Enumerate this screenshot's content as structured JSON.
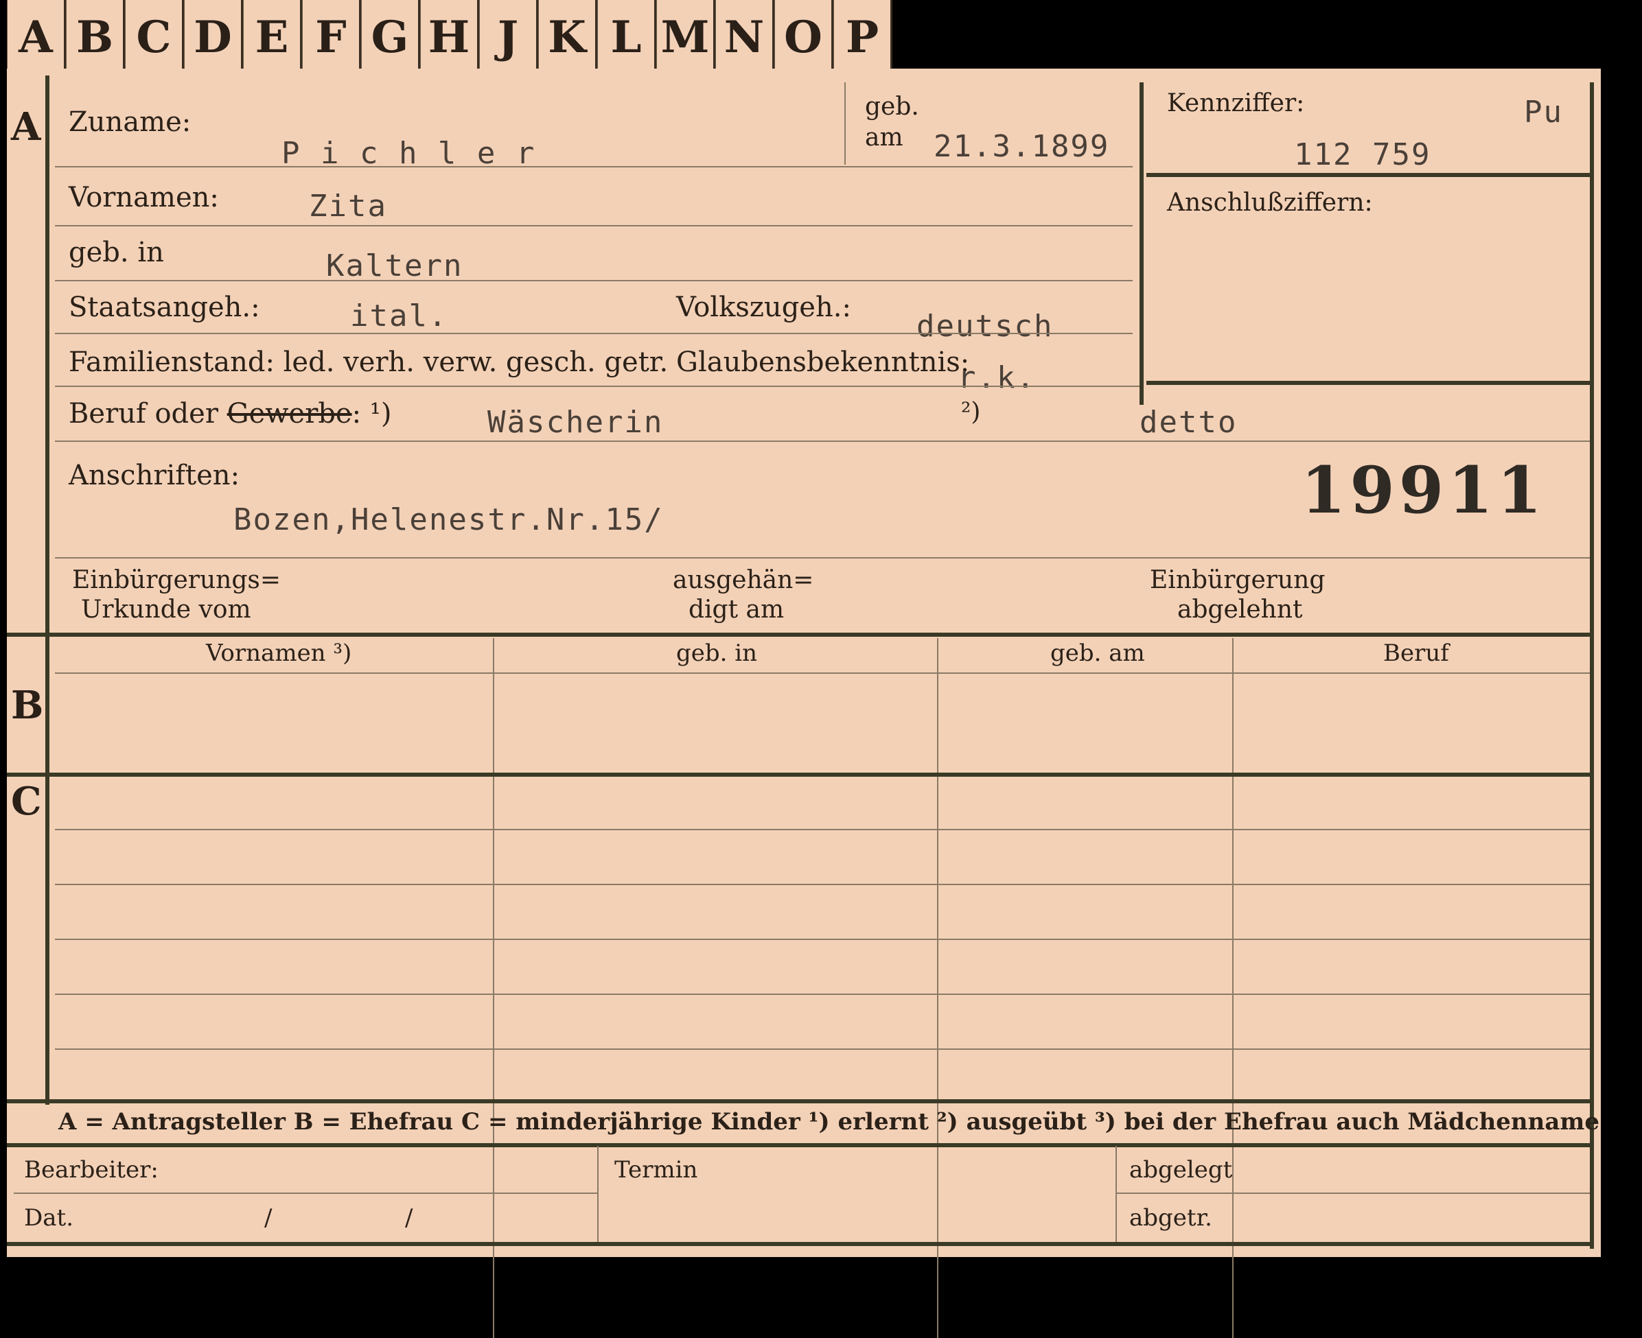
{
  "tabs": [
    "A",
    "B",
    "C",
    "D",
    "E",
    "F",
    "G",
    "H",
    "J",
    "K",
    "L",
    "M",
    "N",
    "O",
    "P"
  ],
  "sections": {
    "a": "A",
    "b": "B",
    "c": "C"
  },
  "labels": {
    "zuname": "Zuname:",
    "geb": "geb.",
    "am": "am",
    "kennziffer": "Kennziffer:",
    "vornamen": "Vornamen:",
    "anschlussziffern": "Anschlußziffern:",
    "geb_in": "geb. in",
    "staatsangeh": "Staatsangeh.:",
    "volkszugeh": "Volkszugeh.:",
    "familienstand": "Familienstand: led. verh. verw. gesch. getr.",
    "glaubensbekenntnis": "Glaubensbekenntnis:",
    "beruf": "Beruf oder ",
    "gewerbe": "Gewerbe",
    "beruf_tail": ": ¹)",
    "note2": "²)",
    "anschriften": "Anschriften:",
    "einb_urkunde_1": "Einbürgerungs=",
    "einb_urkunde_2": "Urkunde vom",
    "ausgehaen_1": "ausgehän=",
    "ausgehaen_2": "digt am",
    "einb_abgelehnt_1": "Einbürgerung",
    "einb_abgelehnt_2": "abgelehnt",
    "col_vornamen": "Vornamen ³)",
    "col_geb_in": "geb. in",
    "col_geb_am": "geb. am",
    "col_beruf": "Beruf",
    "legend": "A = Antragsteller   B = Ehefrau   C = minderjährige Kinder   ¹) erlernt   ²) ausgeübt   ³) bei der Ehefrau auch Mädchenname",
    "bearbeiter": "Bearbeiter:",
    "dat": "Dat.",
    "slash1": "/",
    "slash2": "/",
    "termin": "Termin",
    "abgelegt": "abgelegt",
    "abgetr": "abgetr."
  },
  "values": {
    "zuname": "P i c h l e r",
    "geb_am": "21.3.1899",
    "kennziffer_code": "Pu",
    "kennziffer": "112 759",
    "vornamen": "Zita",
    "geb_in": "Kaltern",
    "staatsangeh": "ital.",
    "volkszugeh": "deutsch",
    "glaubensbekenntnis": "r.k.",
    "beruf1": "Wäscherin",
    "beruf2": "detto",
    "stamp_number": "19911",
    "anschrift": "Bozen,Helenestr.Nr.15/"
  }
}
